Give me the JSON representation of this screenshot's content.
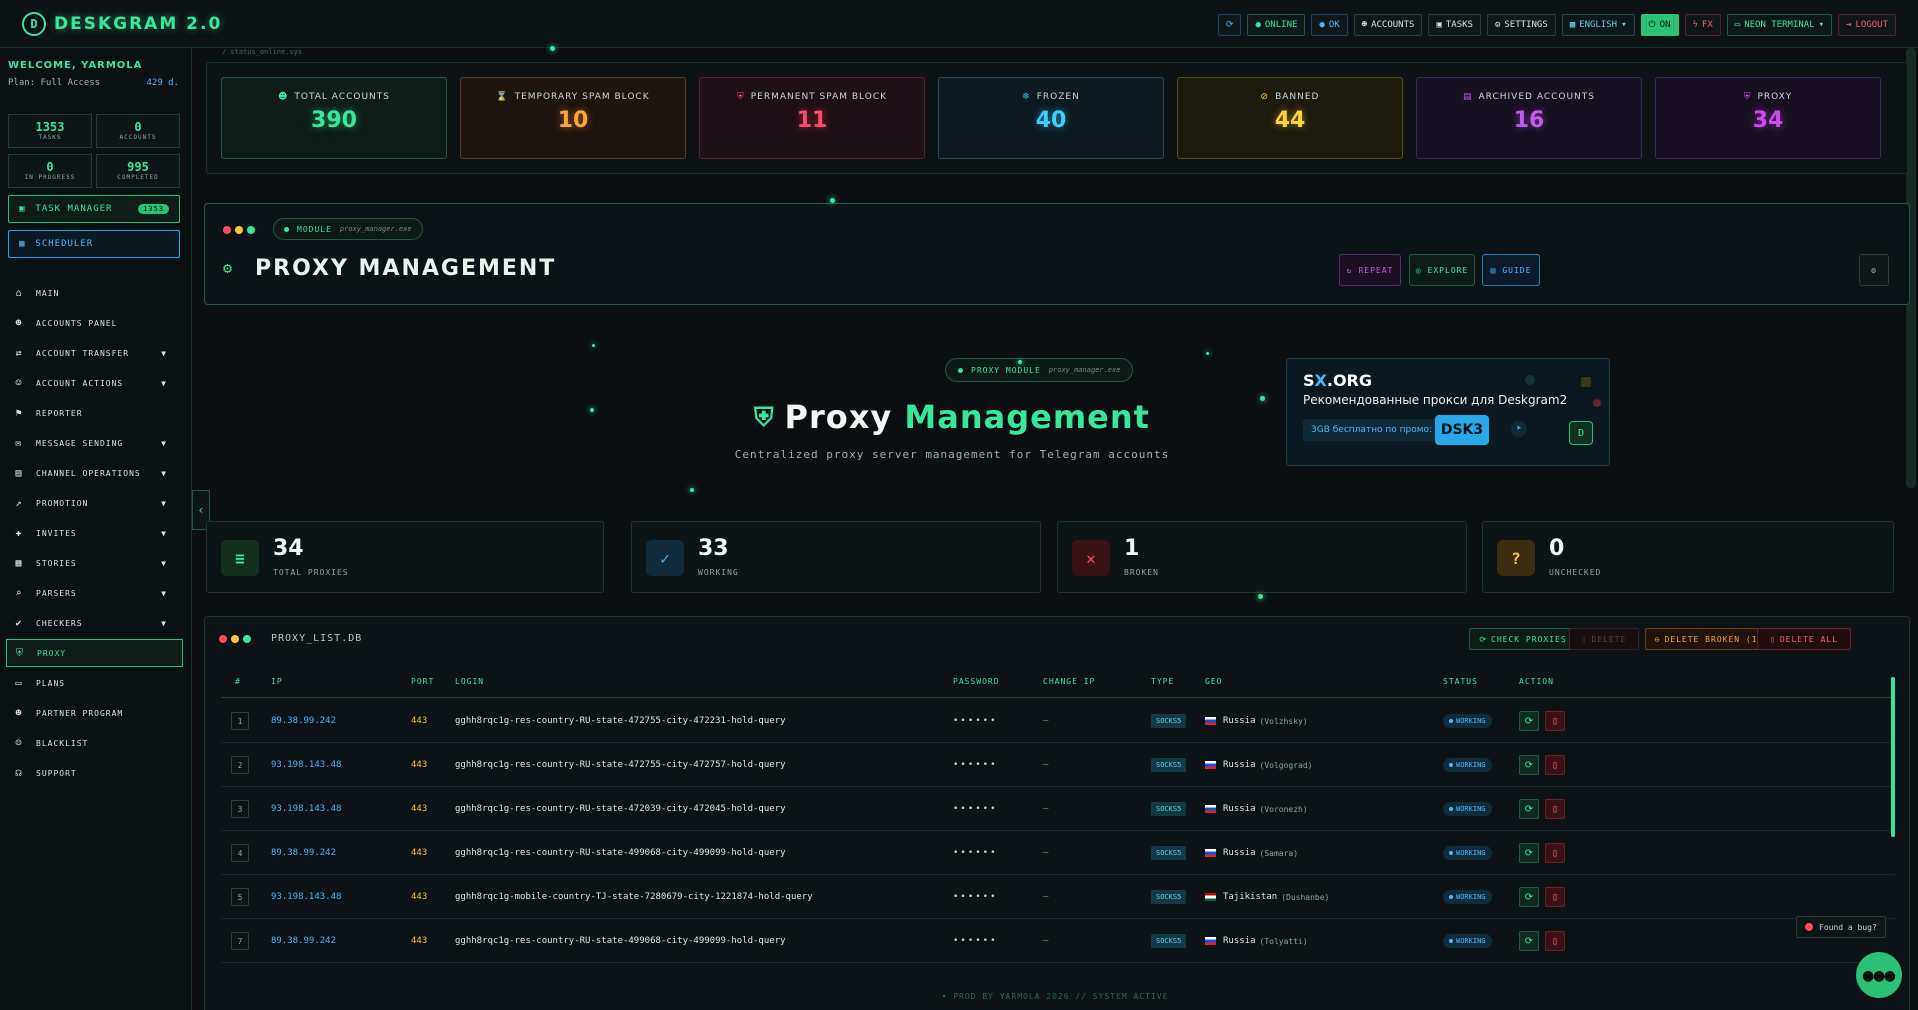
{
  "app": {
    "title": "DESKGRAM 2.0",
    "logo_glyph": "D"
  },
  "topbar": {
    "buttons": [
      {
        "key": "refresh",
        "label": "⟳"
      },
      {
        "key": "online",
        "label": "ONLINE"
      },
      {
        "key": "ok",
        "label": "OK"
      },
      {
        "key": "accounts",
        "label": "ACCOUNTS"
      },
      {
        "key": "tasks",
        "label": "TASKS"
      },
      {
        "key": "settings",
        "label": "SETTINGS"
      },
      {
        "key": "language",
        "label": "ENGLISH"
      },
      {
        "key": "on",
        "label": "ON"
      },
      {
        "key": "fx",
        "label": "FX"
      },
      {
        "key": "theme",
        "label": "NEON TERMINAL"
      },
      {
        "key": "logout",
        "label": "LOGOUT"
      }
    ]
  },
  "sidebar": {
    "welcome": "WELCOME, YARMOLA",
    "plan": "Plan: Full Access",
    "days": "429 d.",
    "stats": [
      {
        "value": "1353",
        "label": "TASKS"
      },
      {
        "value": "0",
        "label": "ACCOUNTS"
      },
      {
        "value": "0",
        "label": "IN PROGRESS"
      },
      {
        "value": "995",
        "label": "COMPLETED"
      }
    ],
    "task_manager": {
      "label": "TASK MANAGER",
      "badge": "1353"
    },
    "scheduler": {
      "label": "SCHEDULER"
    },
    "items": [
      {
        "label": "MAIN",
        "icon": "home-icon",
        "glyph": "⌂",
        "caret": false
      },
      {
        "label": "ACCOUNTS PANEL",
        "icon": "users-icon",
        "glyph": "☻",
        "caret": false
      },
      {
        "label": "ACCOUNT TRANSFER",
        "icon": "transfer-icon",
        "glyph": "⇄",
        "caret": true
      },
      {
        "label": "ACCOUNT ACTIONS",
        "icon": "user-gear-icon",
        "glyph": "☺",
        "caret": true
      },
      {
        "label": "REPORTER",
        "icon": "flag-icon",
        "glyph": "⚑",
        "caret": false
      },
      {
        "label": "MESSAGE SENDING",
        "icon": "chat-icon",
        "glyph": "✉",
        "caret": true
      },
      {
        "label": "CHANNEL OPERATIONS",
        "icon": "channel-icon",
        "glyph": "▤",
        "caret": true
      },
      {
        "label": "PROMOTION",
        "icon": "chart-icon",
        "glyph": "↗",
        "caret": true
      },
      {
        "label": "INVITES",
        "icon": "invite-icon",
        "glyph": "✚",
        "caret": true
      },
      {
        "label": "STORIES",
        "icon": "stories-icon",
        "glyph": "▦",
        "caret": true
      },
      {
        "label": "PARSERS",
        "icon": "search-icon",
        "glyph": "⌕",
        "caret": true
      },
      {
        "label": "CHECKERS",
        "icon": "check-icon",
        "glyph": "✔",
        "caret": true
      },
      {
        "label": "PROXY",
        "icon": "shield-icon",
        "glyph": "⛨",
        "caret": false,
        "active": true
      },
      {
        "label": "PLANS",
        "icon": "card-icon",
        "glyph": "▭",
        "caret": false
      },
      {
        "label": "PARTNER PROGRAM",
        "icon": "partner-icon",
        "glyph": "☻",
        "caret": false
      },
      {
        "label": "BLACKLIST",
        "icon": "block-user-icon",
        "glyph": "☹",
        "caret": false
      },
      {
        "label": "SUPPORT",
        "icon": "headset-icon",
        "glyph": "☊",
        "caret": false
      }
    ]
  },
  "main": {
    "breadcrumb": "/ status_online.sys",
    "account_cards": [
      {
        "title": "TOTAL ACCOUNTS",
        "value": "390",
        "color": "#38e89a",
        "bg": "#0f1d18",
        "border": "#1e5a43",
        "glyph": "☻",
        "icon": "users-icon"
      },
      {
        "title": "TEMPORARY SPAM BLOCK",
        "value": "10",
        "color": "#ffa43a",
        "bg": "#1d1510",
        "border": "#5a3a1e",
        "glyph": "⌛",
        "icon": "hourglass-icon"
      },
      {
        "title": "PERMANENT SPAM BLOCK",
        "value": "11",
        "color": "#ff4a6a",
        "bg": "#1d1016",
        "border": "#5a1e2c",
        "glyph": "⛨",
        "icon": "shield-alert-icon"
      },
      {
        "title": "FROZEN",
        "value": "40",
        "color": "#3ad0ff",
        "bg": "#0e1a20",
        "border": "#1e4a5a",
        "glyph": "❄",
        "icon": "snowflake-icon"
      },
      {
        "title": "BANNED",
        "value": "44",
        "color": "#ffd23a",
        "bg": "#1d1a0e",
        "border": "#5a4a1e",
        "glyph": "⊘",
        "icon": "ban-icon"
      },
      {
        "title": "ARCHIVED ACCOUNTS",
        "value": "16",
        "color": "#c05af0",
        "bg": "#161020",
        "border": "#3e2458",
        "glyph": "▤",
        "icon": "archive-icon"
      },
      {
        "title": "PROXY",
        "value": "34",
        "color": "#d04af0",
        "bg": "#181020",
        "border": "#40245a",
        "glyph": "⛨",
        "icon": "shield-icon"
      }
    ],
    "module": {
      "pill_label": "MODULE",
      "pill_file": "proxy_manager.exe",
      "title": "PROXY MANAGEMENT",
      "buttons": [
        {
          "label": "REPEAT",
          "color": "#c05af0",
          "border": "#5a2a6e",
          "bg": "#1a1020",
          "glyph": "↻"
        },
        {
          "label": "EXPLORE",
          "color": "#38e89a",
          "border": "#1e5a43",
          "bg": "#0f1d18",
          "glyph": "◎"
        },
        {
          "label": "GUIDE",
          "color": "#4ab8ff",
          "border": "#2a7ab8",
          "bg": "#0e1c2a",
          "glyph": "▥"
        }
      ]
    },
    "hero": {
      "pill_label": "PROXY MODULE",
      "pill_file": "proxy_manager.exe",
      "title_1": "Proxy",
      "title_2": "Management",
      "subtitle": "Centralized proxy server management for Telegram accounts"
    },
    "promo": {
      "brand_1": "S",
      "brand_x": "X",
      "brand_2": ".ORG",
      "headline": "Рекомендованные прокси для Deskgram2",
      "free": "3GB бесплатно по промо:",
      "code": "DSK3"
    },
    "proxy_stats": [
      {
        "value": "34",
        "label": "TOTAL PROXIES",
        "icon": "database-icon",
        "glyph": "≡",
        "color": "#38e89a",
        "bg": "#11301f"
      },
      {
        "value": "33",
        "label": "WORKING",
        "icon": "check-circle-icon",
        "glyph": "✓",
        "color": "#4ab8ff",
        "bg": "#102a3a"
      },
      {
        "value": "1",
        "label": "BROKEN",
        "icon": "x-circle-icon",
        "glyph": "✕",
        "color": "#ff4a5a",
        "bg": "#3a1216"
      },
      {
        "value": "0",
        "label": "UNCHECKED",
        "icon": "question-icon",
        "glyph": "?",
        "color": "#ffc53a",
        "bg": "#3a2c0e"
      }
    ],
    "list": {
      "title": "PROXY_LIST.DB",
      "buttons": [
        {
          "label": "CHECK PROXIES",
          "color": "#38e89a",
          "border": "#1e5a43",
          "bg": "#0f1d18",
          "glyph": "⟳"
        },
        {
          "label": "DELETE",
          "color": "#6a3a3e",
          "border": "#3a1e22",
          "bg": "#140e10",
          "glyph": "▯"
        },
        {
          "label": "DELETE BROKEN (1)",
          "color": "#ffa43a",
          "border": "#6a3e1a",
          "bg": "#1e140c",
          "glyph": "⊖"
        },
        {
          "label": "DELETE ALL",
          "color": "#ff5b6a",
          "border": "#6a1e26",
          "bg": "#1e0e10",
          "glyph": "▯"
        }
      ],
      "columns": [
        "#",
        "IP",
        "PORT",
        "LOGIN",
        "PASSWORD",
        "CHANGE IP",
        "TYPE",
        "GEO",
        "STATUS",
        "ACTION"
      ],
      "rows": [
        {
          "n": "1",
          "ip": "89.38.99.242",
          "port": "443",
          "login": "gghh8rqc1g-res-country-RU-state-472755-city-472231-hold-query",
          "password": "••••••",
          "change_ip": "—",
          "type": "SOCKS5",
          "flag": "ru",
          "country": "Russia",
          "city": "(Volzhsky)",
          "status": "WORKING"
        },
        {
          "n": "2",
          "ip": "93.198.143.48",
          "port": "443",
          "login": "gghh8rqc1g-res-country-RU-state-472755-city-472757-hold-query",
          "password": "••••••",
          "change_ip": "—",
          "type": "SOCKS5",
          "flag": "ru",
          "country": "Russia",
          "city": "(Volgograd)",
          "status": "WORKING"
        },
        {
          "n": "3",
          "ip": "93.198.143.48",
          "port": "443",
          "login": "gghh8rqc1g-res-country-RU-state-472039-city-472045-hold-query",
          "password": "••••••",
          "change_ip": "—",
          "type": "SOCKS5",
          "flag": "ru",
          "country": "Russia",
          "city": "(Voronezh)",
          "status": "WORKING"
        },
        {
          "n": "4",
          "ip": "89.38.99.242",
          "port": "443",
          "login": "gghh8rqc1g-res-country-RU-state-499068-city-499099-hold-query",
          "password": "••••••",
          "change_ip": "—",
          "type": "SOCKS5",
          "flag": "ru",
          "country": "Russia",
          "city": "(Samara)",
          "status": "WORKING"
        },
        {
          "n": "5",
          "ip": "93.198.143.48",
          "port": "443",
          "login": "gghh8rqc1g-mobile-country-TJ-state-7280679-city-1221874-hold-query",
          "password": "••••••",
          "change_ip": "—",
          "type": "SOCKS5",
          "flag": "tj",
          "country": "Tajikistan",
          "city": "(Dushanbe)",
          "status": "WORKING"
        },
        {
          "n": "7",
          "ip": "89.38.99.242",
          "port": "443",
          "login": "gghh8rqc1g-res-country-RU-state-499068-city-499099-hold-query",
          "password": "••••••",
          "change_ip": "—",
          "type": "SOCKS5",
          "flag": "ru",
          "country": "Russia",
          "city": "(Tolyatti)",
          "status": "WORKING"
        }
      ]
    },
    "footer": "• PROD BY YARMOLA 2026  // SYSTEM ACTIVE",
    "bug_label": "Found a bug?"
  }
}
